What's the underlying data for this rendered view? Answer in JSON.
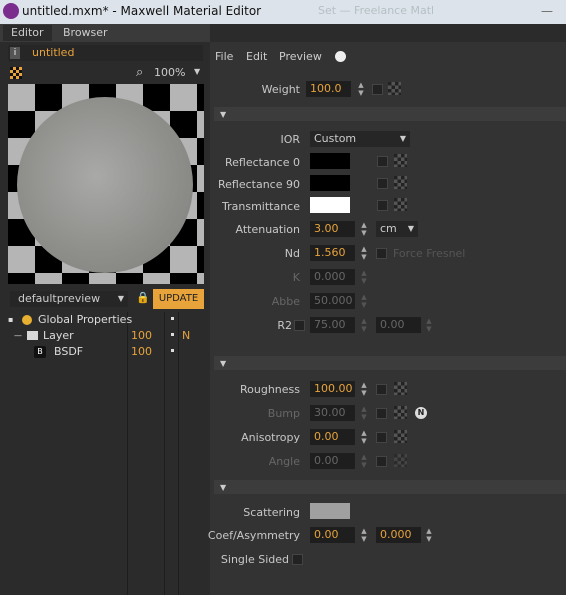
{
  "window": {
    "title": "untitled.mxm* - Maxwell Material Editor",
    "faded_bg_text": "Set — Freelance Matl",
    "minimize": "—"
  },
  "tabs": [
    {
      "label": "Editor"
    },
    {
      "label": "Browser"
    }
  ],
  "material": {
    "name": "untitled"
  },
  "zoom": {
    "value": "100%"
  },
  "preview": {
    "scene": "defaultpreview",
    "update_label": "UPDATE"
  },
  "tree": [
    {
      "label": "Global Properties",
      "value": "",
      "flag": ""
    },
    {
      "label": "Layer",
      "value": "100",
      "flag": "N"
    },
    {
      "label": "BSDF",
      "value": "100",
      "flag": ""
    }
  ],
  "menu": {
    "file": "File",
    "edit": "Edit",
    "preview": "Preview"
  },
  "weight": {
    "label": "Weight",
    "value": "100.0"
  },
  "ior": {
    "label": "IOR",
    "value": "Custom"
  },
  "reflectance0": {
    "label": "Reflectance 0",
    "color": "#000000"
  },
  "reflectance90": {
    "label": "Reflectance 90",
    "color": "#000000"
  },
  "transmittance": {
    "label": "Transmittance",
    "color": "#ffffff"
  },
  "attenuation": {
    "label": "Attenuation",
    "value": "3.00",
    "unit": "cm"
  },
  "nd": {
    "label": "Nd",
    "value": "1.560",
    "force_fresnel": "Force Fresnel"
  },
  "k": {
    "label": "K",
    "value": "0.000"
  },
  "abbe": {
    "label": "Abbe",
    "value": "50.000"
  },
  "r2": {
    "label": "R2",
    "value1": "75.00",
    "value2": "0.00"
  },
  "roughness": {
    "label": "Roughness",
    "value": "100.00"
  },
  "bump": {
    "label": "Bump",
    "value": "30.00"
  },
  "anisotropy": {
    "label": "Anisotropy",
    "value": "0.00"
  },
  "angle": {
    "label": "Angle",
    "value": "0.00"
  },
  "scattering": {
    "label": "Scattering",
    "color": "#a0a0a0"
  },
  "coef": {
    "label": "Coef/Asymmetry",
    "value1": "0.00",
    "value2": "0.000"
  },
  "single_sided": {
    "label": "Single Sided"
  },
  "colors": {
    "accent": "#e8a33a",
    "panel": "#333333"
  }
}
